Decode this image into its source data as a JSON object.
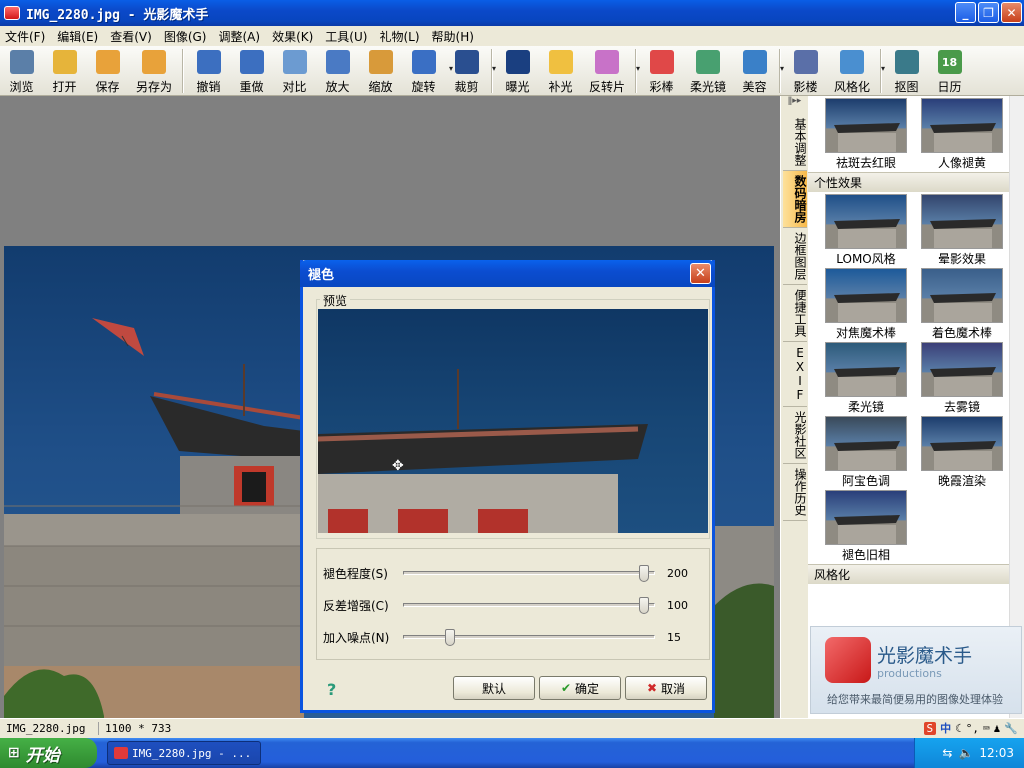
{
  "window": {
    "title": "IMG_2280.jpg - 光影魔术手"
  },
  "menu": [
    "文件(F)",
    "编辑(E)",
    "查看(V)",
    "图像(G)",
    "调整(A)",
    "效果(K)",
    "工具(U)",
    "礼物(L)",
    "帮助(H)"
  ],
  "toolbar": [
    {
      "label": "浏览",
      "icon": "eye-icon",
      "color": "#5b7fa8"
    },
    {
      "label": "打开",
      "icon": "folder-icon",
      "color": "#e6b43a"
    },
    {
      "label": "保存",
      "icon": "save-icon",
      "color": "#e8a23a"
    },
    {
      "label": "另存为",
      "icon": "save-as-icon",
      "color": "#e8a23a"
    },
    {
      "sep": true
    },
    {
      "label": "撤销",
      "icon": "undo-icon",
      "color": "#3c6fc0"
    },
    {
      "label": "重做",
      "icon": "redo-icon",
      "color": "#3c6fc0"
    },
    {
      "label": "对比",
      "icon": "compare-icon",
      "color": "#6c9bd1"
    },
    {
      "label": "放大",
      "icon": "zoom-in-icon",
      "color": "#4a7ac4"
    },
    {
      "label": "缩放",
      "icon": "resize-icon",
      "color": "#d89a3a"
    },
    {
      "label": "旋转",
      "icon": "rotate-icon",
      "color": "#3a6fc4",
      "dropdown": true
    },
    {
      "label": "裁剪",
      "icon": "crop-icon",
      "color": "#2a4f90",
      "dropdown": true
    },
    {
      "sep": true
    },
    {
      "label": "曝光",
      "icon": "exposure-icon",
      "color": "#1a3f80"
    },
    {
      "label": "补光",
      "icon": "fill-light-icon",
      "color": "#f0c040"
    },
    {
      "label": "反转片",
      "icon": "reversal-film-icon",
      "color": "#c872c8",
      "dropdown": true
    },
    {
      "sep": true
    },
    {
      "label": "彩棒",
      "icon": "color-wand-icon",
      "color": "#e04848"
    },
    {
      "label": "柔光镜",
      "icon": "soft-focus-icon",
      "color": "#48a070"
    },
    {
      "label": "美容",
      "icon": "beauty-icon",
      "color": "#3a80c8",
      "dropdown": true
    },
    {
      "sep": true
    },
    {
      "label": "影楼",
      "icon": "studio-icon",
      "color": "#5a6fa8"
    },
    {
      "label": "风格化",
      "icon": "stylize-icon",
      "color": "#4a8fd0",
      "dropdown": true
    },
    {
      "sep": true
    },
    {
      "label": "抠图",
      "icon": "cutout-icon",
      "color": "#3a7a8a"
    },
    {
      "label": "日历",
      "icon": "calendar-icon",
      "color": "#4a9a4a",
      "text": "18"
    }
  ],
  "side_tabs": [
    {
      "label": "基本调整",
      "active": false
    },
    {
      "label": "数码暗房",
      "active": true
    },
    {
      "label": "边框图层",
      "active": false
    },
    {
      "label": "便捷工具",
      "active": false
    },
    {
      "label": "EXIF",
      "active": false
    },
    {
      "label": "光影社区",
      "active": false
    },
    {
      "label": "操作历史",
      "active": false
    }
  ],
  "panel": {
    "top_items": [
      "祛斑去红眼",
      "人像褪黄"
    ],
    "section1": {
      "title": "个性效果",
      "items": [
        "LOMO风格",
        "晕影效果",
        "对焦魔术棒",
        "着色魔术棒",
        "柔光镜",
        "去雾镜",
        "阿宝色调",
        "晚霞渲染",
        "褪色旧相"
      ]
    },
    "section2": {
      "title": "风格化"
    }
  },
  "promo": {
    "title": "光影魔术手",
    "subtitle": "productions",
    "tagline": "给您带来最简便易用的图像处理体验"
  },
  "dialog": {
    "title": "褪色",
    "preview_label": "预览",
    "sliders": [
      {
        "label": "褪色程度(S)",
        "value": "200",
        "fraction": 0.97
      },
      {
        "label": "反差增强(C)",
        "value": "100",
        "fraction": 0.97
      },
      {
        "label": "加入噪点(N)",
        "value": "15",
        "fraction": 0.17
      }
    ],
    "buttons": {
      "default": "默认",
      "ok": "确定",
      "cancel": "取消"
    },
    "help": "?"
  },
  "status": {
    "filename": "IMG_2280.jpg",
    "dimensions": "1100 * 733"
  },
  "taskbar": {
    "start": "开始",
    "task": "IMG_2280.jpg - ...",
    "clock": "12:03"
  }
}
